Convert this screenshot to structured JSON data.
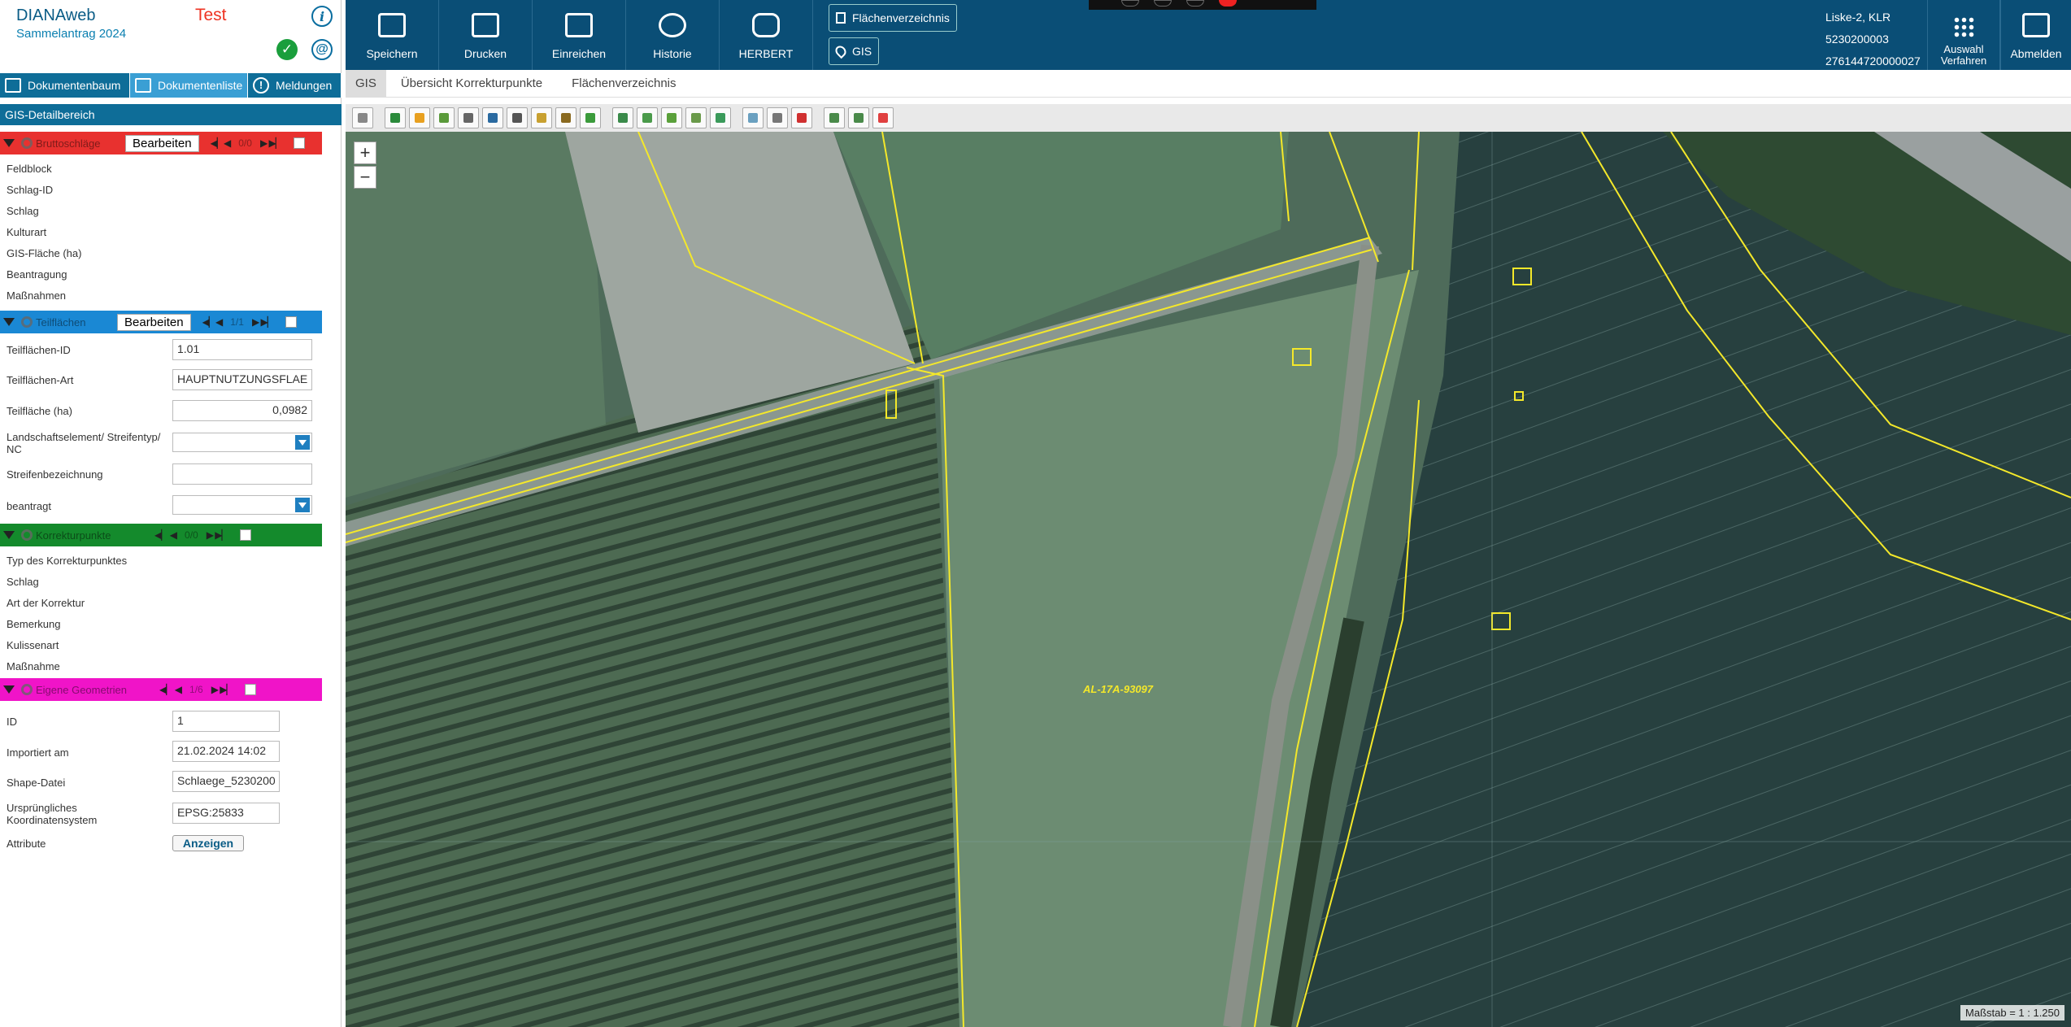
{
  "app": {
    "title": "DIANAweb",
    "subtitle": "Sammelantrag 2024",
    "env": "Test"
  },
  "left_tabs": [
    {
      "label": "Dokumentenbaum"
    },
    {
      "label": "Dokumentenliste"
    },
    {
      "label": "Meldungen"
    }
  ],
  "detail_title": "GIS-Detailbereich",
  "sections": {
    "brutto": {
      "name": "Bruttoschläge",
      "edit": "Bearbeiten",
      "count": "0/0",
      "fields": [
        "Feldblock",
        "Schlag-ID",
        "Schlag",
        "Kulturart",
        "GIS-Fläche (ha)",
        "Beantragung",
        "Maßnahmen"
      ]
    },
    "teil": {
      "name": "Teilflächen",
      "edit": "Bearbeiten",
      "count": "1/1",
      "fields": {
        "id_label": "Teilflächen-ID",
        "id_value": "1.01",
        "art_label": "Teilflächen-Art",
        "art_value": "HAUPTNUTZUNGSFLAE",
        "flaeche_label": "Teilfläche (ha)",
        "flaeche_value": "0,0982",
        "land_label": "Landschaftselement/ Streifentyp/ NC",
        "streifen_label": "Streifenbezeichnung",
        "beantragt_label": "beantragt"
      }
    },
    "korr": {
      "name": "Korrekturpunkte",
      "count": "0/0",
      "fields": [
        "Typ des Korrekturpunktes",
        "Schlag",
        "Art der Korrektur",
        "Bemerkung",
        "Kulissenart",
        "Maßnahme"
      ]
    },
    "eigen": {
      "name": "Eigene Geometrien",
      "count": "1/6",
      "fields": {
        "id_label": "ID",
        "id_value": "1",
        "imp_label": "Importiert am",
        "imp_value": "21.02.2024 14:02",
        "shape_label": "Shape-Datei",
        "shape_value": "Schlaege_5230200",
        "koord_label": "Ursprüngliches Koordinatensystem",
        "koord_value": "EPSG:25833",
        "attr_label": "Attribute",
        "attr_button": "Anzeigen"
      }
    }
  },
  "toolbar": {
    "speichern": "Speichern",
    "drucken": "Drucken",
    "einreichen": "Einreichen",
    "historie": "Historie",
    "herbert": "HERBERT",
    "flaechenverzeichnis": "Flächenverzeichnis",
    "gis": "GIS",
    "user_name": "Liske-2, KLR",
    "user_id1": "5230200003",
    "user_id2": "276144720000027",
    "auswahl_line1": "Auswahl",
    "auswahl_line2": "Verfahren",
    "abmelden": "Abmelden"
  },
  "subtabs": [
    "GIS",
    "Übersicht Korrekturpunkte",
    "Flächenverzeichnis"
  ],
  "map": {
    "parcel_label": "AL-17A-93097",
    "scale": "Maßstab = 1 : 1.250"
  },
  "colors": {
    "brutto": "#e8312f",
    "teil": "#1a88d4",
    "korr": "#148a2c",
    "eigen": "#f014c8",
    "header": "#0a4e76",
    "outline": "#f4e82a"
  }
}
